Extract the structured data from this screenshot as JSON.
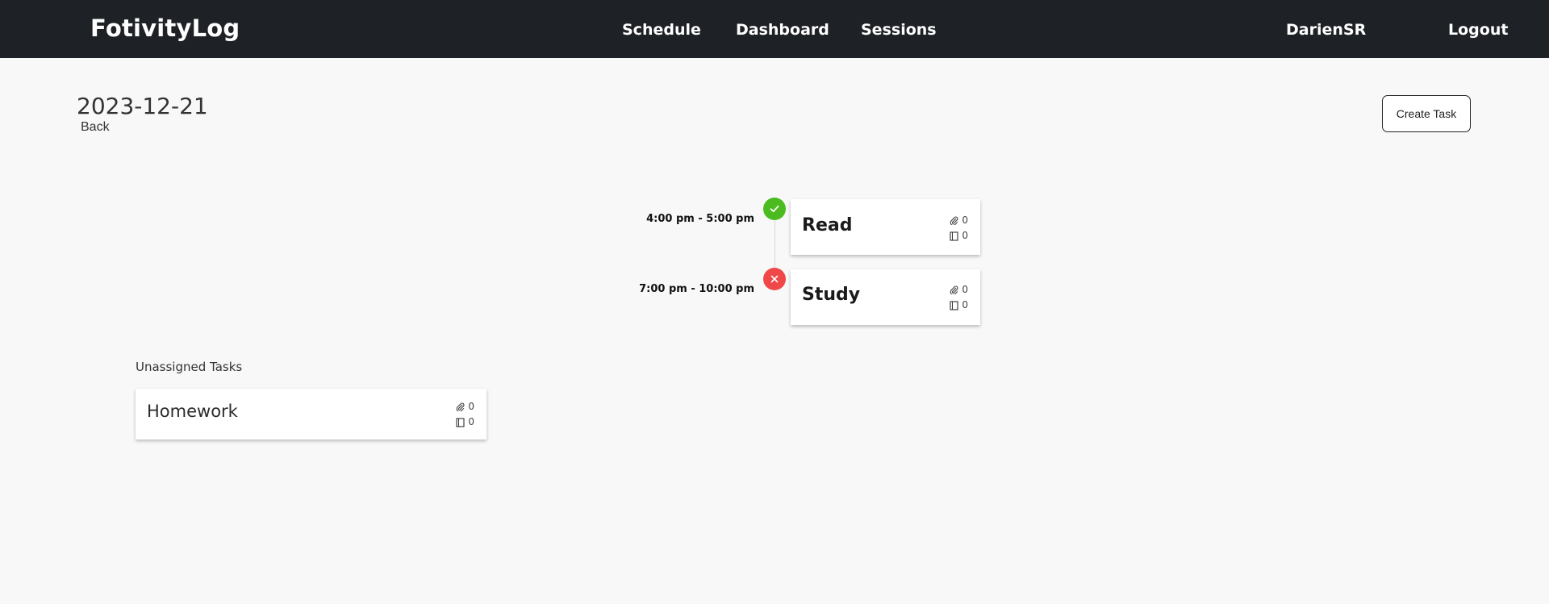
{
  "navbar": {
    "brand": "FotivityLog",
    "links": [
      "Schedule",
      "Dashboard",
      "Sessions"
    ],
    "user": "DarienSR",
    "logout": "Logout"
  },
  "page": {
    "date": "2023-12-21",
    "back_label": "Back",
    "create_task_label": "Create Task"
  },
  "schedule": {
    "tasks": [
      {
        "time": "4:00 pm - 5:00 pm",
        "title": "Read",
        "status": "complete",
        "status_icon": "check-icon",
        "attachments": "0",
        "notes": "0"
      },
      {
        "time": "7:00 pm - 10:00 pm",
        "title": "Study",
        "status": "incomplete",
        "status_icon": "x-icon",
        "attachments": "0",
        "notes": "0"
      }
    ]
  },
  "unassigned": {
    "label": "Unassigned Tasks",
    "tasks": [
      {
        "title": "Homework",
        "attachments": "0",
        "notes": "0"
      }
    ]
  },
  "colors": {
    "navbar": "#1e2125",
    "complete": "#4bbb1f",
    "incomplete": "#f04848"
  }
}
